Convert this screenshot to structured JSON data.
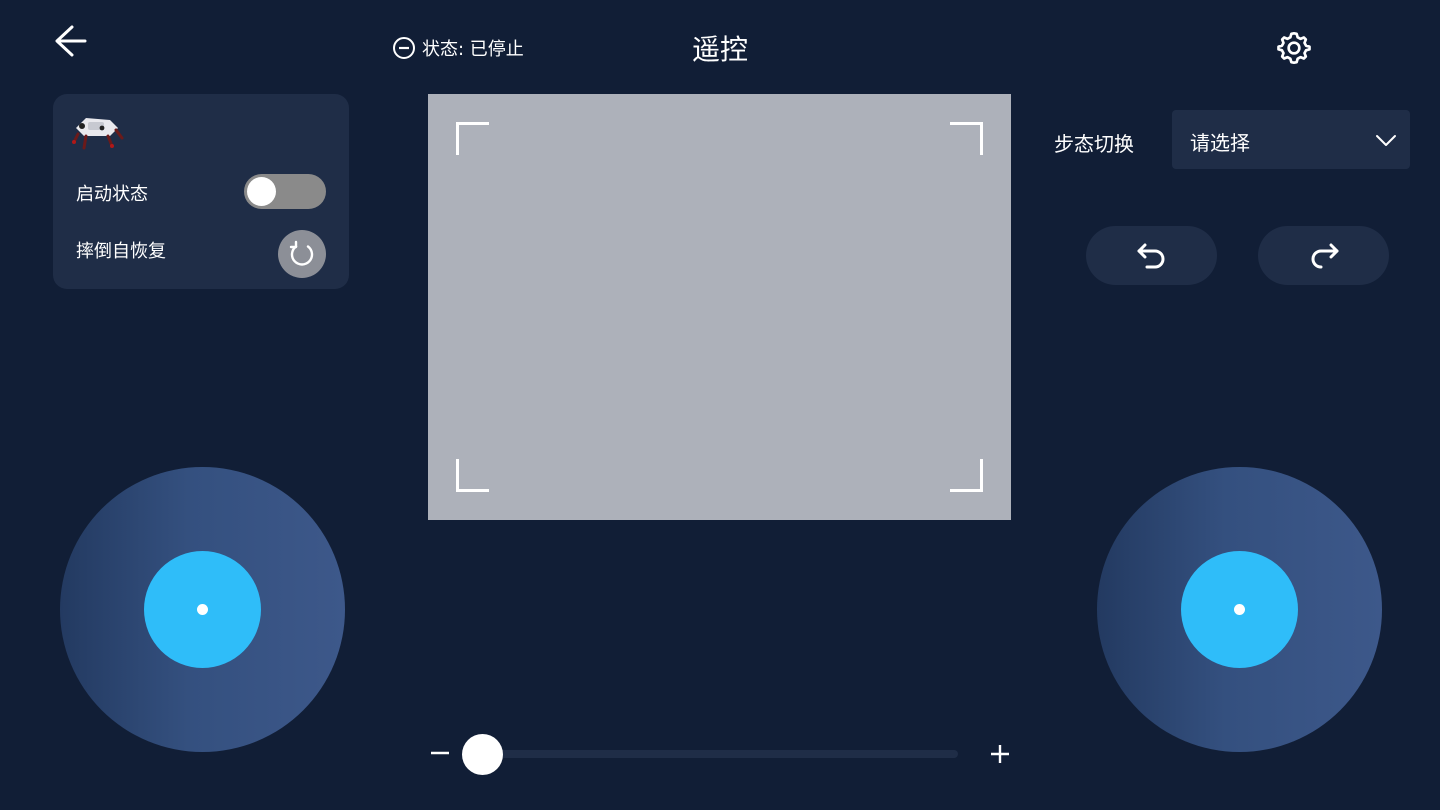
{
  "header": {
    "title": "遥控",
    "status_label": "状态: 已停止",
    "icons": {
      "back": "back-arrow-icon",
      "status": "stop-circle-icon",
      "settings": "gear-icon"
    }
  },
  "controls": {
    "start_label": "启动状态",
    "start_enabled": false,
    "recover_label": "摔倒自恢复"
  },
  "gait": {
    "label": "步态切换",
    "value": "请选择"
  },
  "rotation": {
    "left_icon": "rotate-left-icon",
    "right_icon": "rotate-right-icon"
  },
  "zoom": {
    "minus": "−",
    "plus": "+",
    "level": 0
  },
  "colors": {
    "background": "#111e36",
    "panel": "#1f2d47",
    "joystick_knob": "#2fbdf9",
    "camera_placeholder": "#adb1ba"
  }
}
